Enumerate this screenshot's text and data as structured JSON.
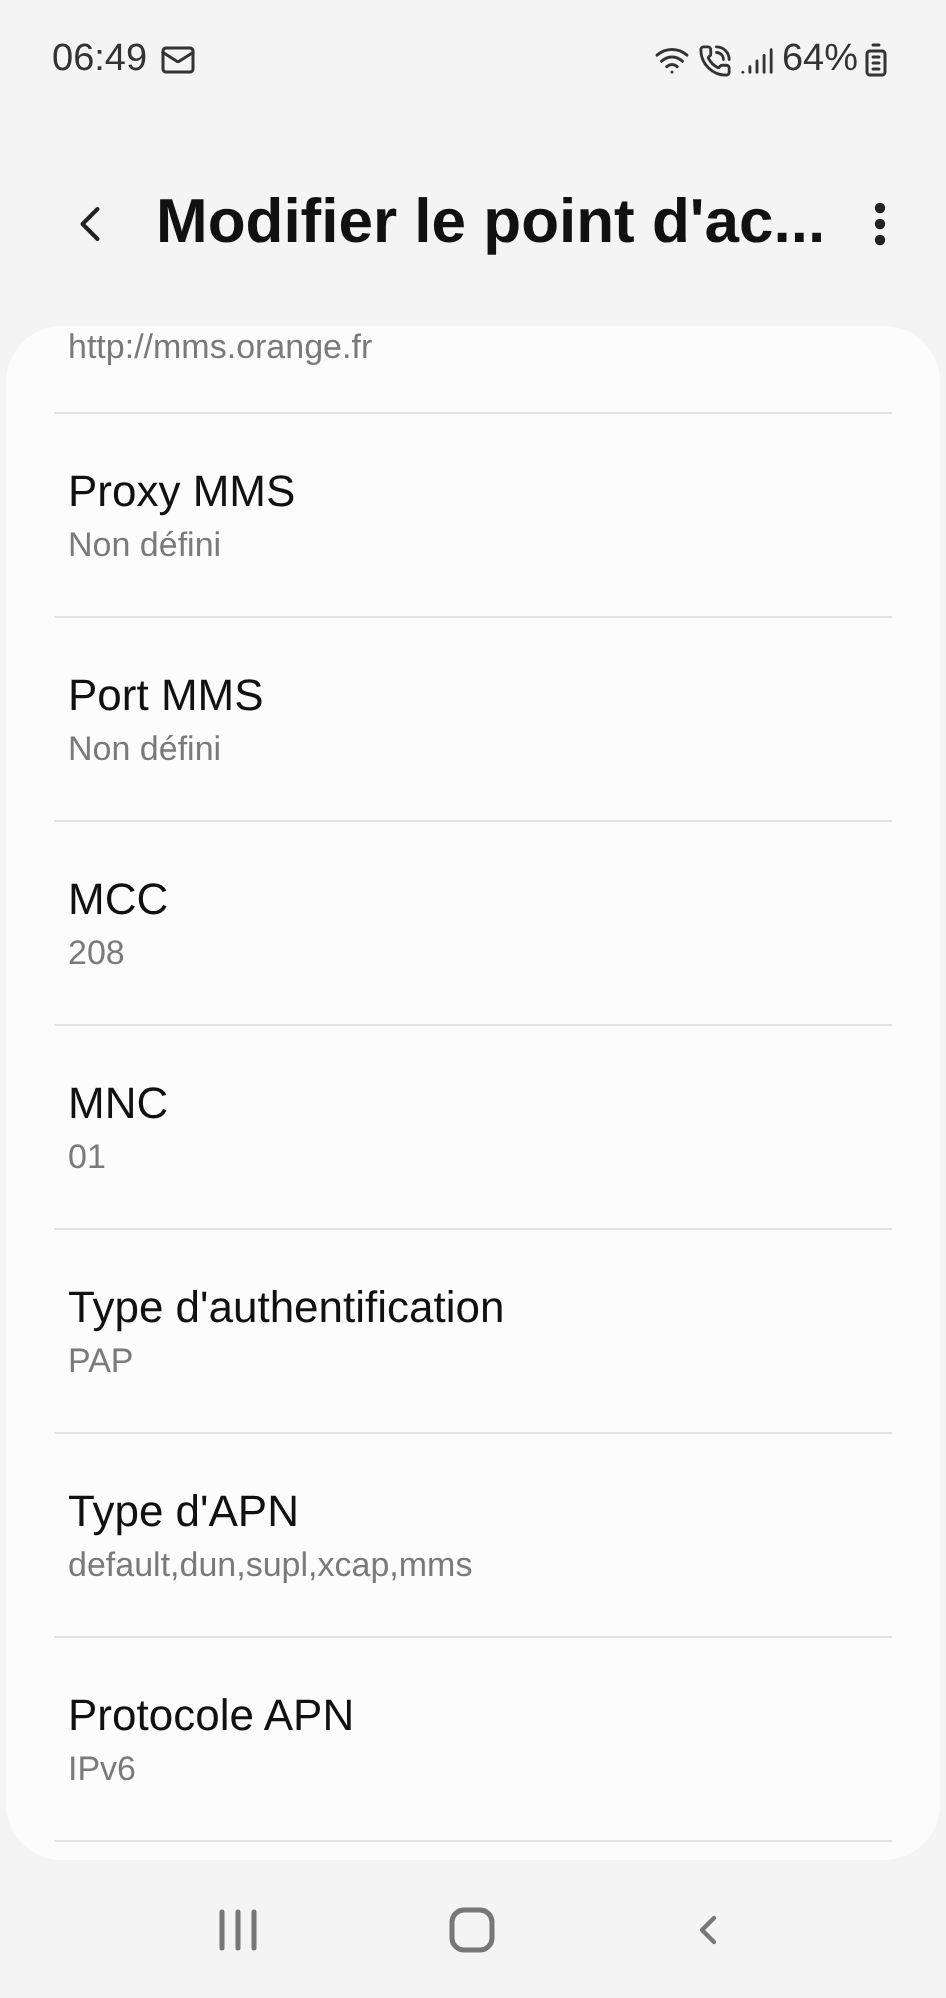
{
  "status_bar": {
    "time": "06:49",
    "battery": "64%"
  },
  "header": {
    "title": "Modifier le point d'ac..."
  },
  "partial_value": "http://mms.orange.fr",
  "settings": [
    {
      "title": "Proxy MMS",
      "value": "Non défini"
    },
    {
      "title": "Port MMS",
      "value": "Non défini"
    },
    {
      "title": "MCC",
      "value": "208"
    },
    {
      "title": "MNC",
      "value": "01"
    },
    {
      "title": "Type d'authentification",
      "value": "PAP"
    },
    {
      "title": "Type d'APN",
      "value": "default,dun,supl,xcap,mms"
    },
    {
      "title": "Protocole APN",
      "value": "IPv6"
    }
  ]
}
